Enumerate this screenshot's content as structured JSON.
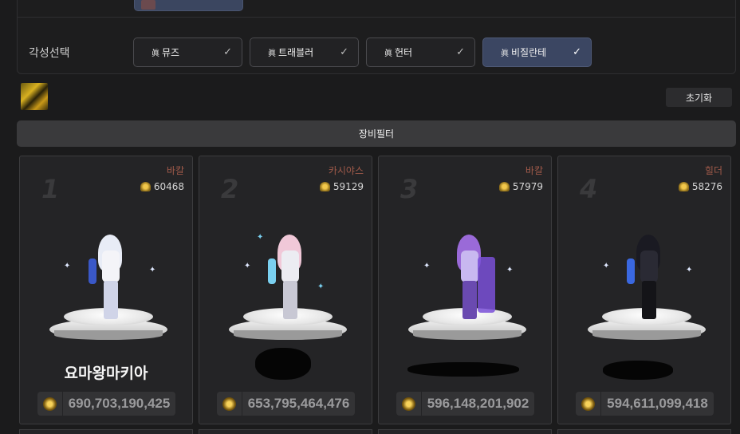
{
  "awakening": {
    "label": "각성선택",
    "options": [
      {
        "mark": "眞",
        "name": "뮤즈",
        "active": false
      },
      {
        "mark": "眞",
        "name": "트래블러",
        "active": false
      },
      {
        "mark": "眞",
        "name": "헌터",
        "active": false
      },
      {
        "mark": "眞",
        "name": "비질란테",
        "active": true
      }
    ],
    "check_glyph": "✓"
  },
  "toolbar": {
    "selected_icon": "gold-equipment-icon",
    "reset_label": "초기화",
    "filter_label": "장비필터"
  },
  "ranking": [
    {
      "rank": "1",
      "class": "바칼",
      "fame": "60468",
      "name": "요마왕마키아",
      "name_hidden": false,
      "power": "690,703,190,425",
      "hair": "#e8ecf6",
      "body": "#f4f4f8",
      "accent": "#3a58c8"
    },
    {
      "rank": "2",
      "class": "카시야스",
      "fame": "59129",
      "name": "",
      "name_hidden": true,
      "power": "653,795,464,476",
      "hair": "#f0c8d8",
      "body": "#ececf2",
      "accent": "#7ad0f0"
    },
    {
      "rank": "3",
      "class": "바칼",
      "fame": "57979",
      "name": "",
      "name_hidden": true,
      "power": "596,148,201,902",
      "hair": "#9a6ad8",
      "body": "#c8b8f0",
      "accent": "#7a50d8"
    },
    {
      "rank": "4",
      "class": "힐더",
      "fame": "58276",
      "name": "",
      "name_hidden": true,
      "power": "594,611,099,418",
      "hair": "#1a1a22",
      "body": "#2a2a34",
      "accent": "#3a68e0"
    }
  ]
}
